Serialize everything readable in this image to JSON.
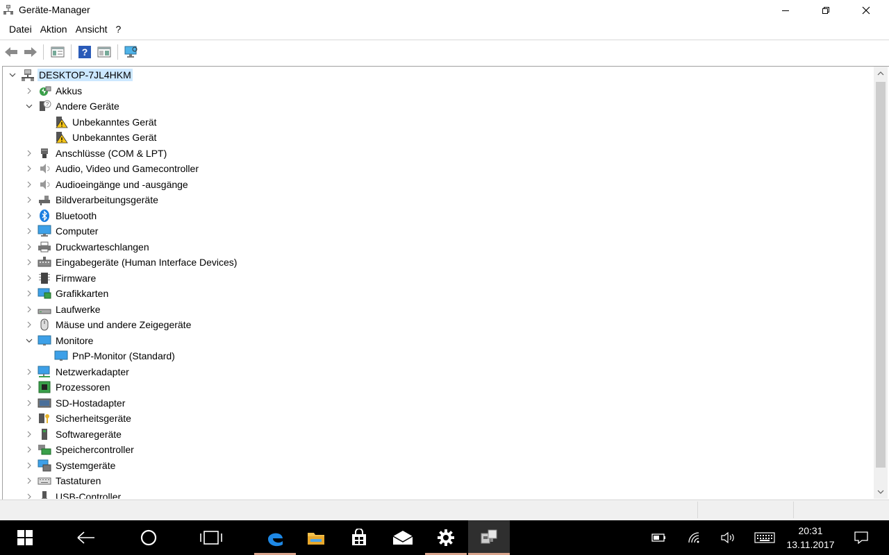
{
  "window": {
    "title": "Geräte-Manager"
  },
  "menu": [
    "Datei",
    "Aktion",
    "Ansicht",
    "?"
  ],
  "tree": {
    "root": "DESKTOP-7JL4HKM",
    "items": [
      {
        "label": "Akkus",
        "expanded": false,
        "icon": "battery-icon"
      },
      {
        "label": "Andere Geräte",
        "expanded": true,
        "icon": "unknown-device-icon",
        "children": [
          {
            "label": "Unbekanntes Gerät",
            "icon": "warning-device-icon"
          },
          {
            "label": "Unbekanntes Gerät",
            "icon": "warning-device-icon"
          }
        ]
      },
      {
        "label": "Anschlüsse (COM & LPT)",
        "expanded": false,
        "icon": "port-icon"
      },
      {
        "label": "Audio, Video und Gamecontroller",
        "expanded": false,
        "icon": "speaker-icon"
      },
      {
        "label": "Audioeingänge und -ausgänge",
        "expanded": false,
        "icon": "speaker-icon"
      },
      {
        "label": "Bildverarbeitungsgeräte",
        "expanded": false,
        "icon": "camera-icon"
      },
      {
        "label": "Bluetooth",
        "expanded": false,
        "icon": "bluetooth-icon"
      },
      {
        "label": "Computer",
        "expanded": false,
        "icon": "computer-icon"
      },
      {
        "label": "Druckwarteschlangen",
        "expanded": false,
        "icon": "printer-icon"
      },
      {
        "label": "Eingabegeräte (Human Interface Devices)",
        "expanded": false,
        "icon": "hid-icon"
      },
      {
        "label": "Firmware",
        "expanded": false,
        "icon": "chip-icon"
      },
      {
        "label": "Grafikkarten",
        "expanded": false,
        "icon": "display-adapter-icon"
      },
      {
        "label": "Laufwerke",
        "expanded": false,
        "icon": "drive-icon"
      },
      {
        "label": "Mäuse und andere Zeigegeräte",
        "expanded": false,
        "icon": "mouse-icon"
      },
      {
        "label": "Monitore",
        "expanded": true,
        "icon": "monitor-icon",
        "children": [
          {
            "label": "PnP-Monitor (Standard)",
            "icon": "monitor-icon"
          }
        ]
      },
      {
        "label": "Netzwerkadapter",
        "expanded": false,
        "icon": "network-icon"
      },
      {
        "label": "Prozessoren",
        "expanded": false,
        "icon": "processor-icon"
      },
      {
        "label": "SD-Hostadapter",
        "expanded": false,
        "icon": "sd-icon"
      },
      {
        "label": "Sicherheitsgeräte",
        "expanded": false,
        "icon": "security-key-icon"
      },
      {
        "label": "Softwaregeräte",
        "expanded": false,
        "icon": "software-device-icon"
      },
      {
        "label": "Speichercontroller",
        "expanded": false,
        "icon": "storage-controller-icon"
      },
      {
        "label": "Systemgeräte",
        "expanded": false,
        "icon": "system-device-icon"
      },
      {
        "label": "Tastaturen",
        "expanded": false,
        "icon": "keyboard-icon"
      },
      {
        "label": "USB-Controller",
        "expanded": false,
        "icon": "usb-icon"
      }
    ]
  },
  "taskbar": {
    "time": "20:31",
    "date": "13.11.2017"
  },
  "colors": {
    "selection": "#cce8ff",
    "taskbar": "#000000",
    "edge_blue": "#1e88e5",
    "folder_yellow": "#f2c04c",
    "accent_underline": "#d9a48c"
  }
}
